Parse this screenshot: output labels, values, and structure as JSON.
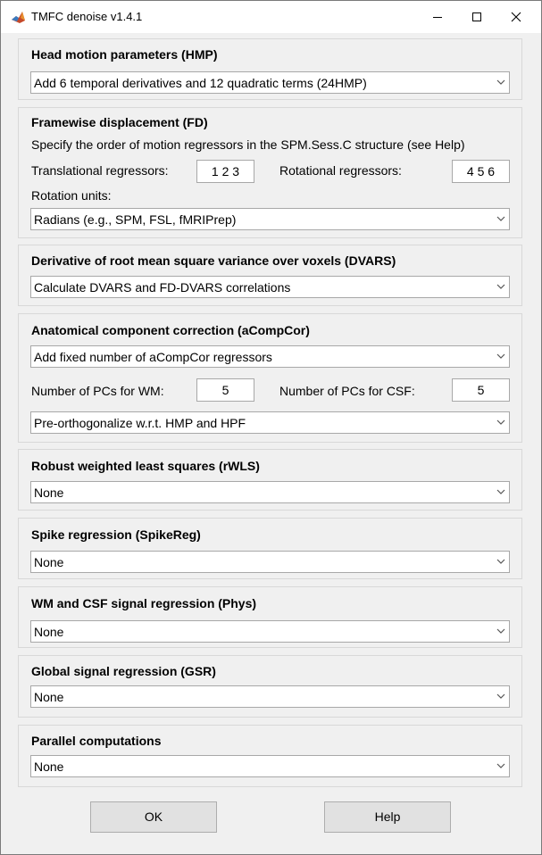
{
  "window": {
    "title": "TMFC denoise v1.4.1"
  },
  "hmp": {
    "title": "Head motion parameters (HMP)",
    "selected": "Add 6 temporal derivatives and 12 quadratic terms (24HMP)"
  },
  "fd": {
    "title": "Framewise displacement (FD)",
    "description": "Specify the order of motion regressors in the SPM.Sess.C structure (see Help)",
    "translational_label": "Translational regressors:",
    "translational_value": "1 2 3",
    "rotational_label": "Rotational regressors:",
    "rotational_value": "4 5 6",
    "units_label": "Rotation units:",
    "units_selected": "Radians (e.g., SPM, FSL, fMRIPrep)"
  },
  "dvars": {
    "title": "Derivative of root mean square variance over voxels (DVARS)",
    "selected": "Calculate DVARS and FD-DVARS correlations"
  },
  "acompcor": {
    "title": "Anatomical component correction (aCompCor)",
    "selected": "Add fixed number of aCompCor regressors",
    "wm_label": "Number of PCs for WM:",
    "wm_value": "5",
    "csf_label": "Number of PCs for CSF:",
    "csf_value": "5",
    "orth_selected": "Pre-orthogonalize w.r.t. HMP and HPF"
  },
  "rwls": {
    "title": "Robust weighted least squares (rWLS)",
    "selected": "None"
  },
  "spikereg": {
    "title": "Spike regression (SpikeReg)",
    "selected": "None"
  },
  "phys": {
    "title": "WM and CSF signal regression (Phys)",
    "selected": "None"
  },
  "gsr": {
    "title": "Global signal regression (GSR)",
    "selected": "None"
  },
  "parallel": {
    "title": "Parallel computations",
    "selected": "None"
  },
  "buttons": {
    "ok": "OK",
    "help": "Help"
  },
  "icons": {
    "app": "matlab-icon",
    "minimize": "minimize-icon",
    "maximize": "maximize-icon",
    "close": "close-icon",
    "dropdown": "chevron-down-icon"
  }
}
